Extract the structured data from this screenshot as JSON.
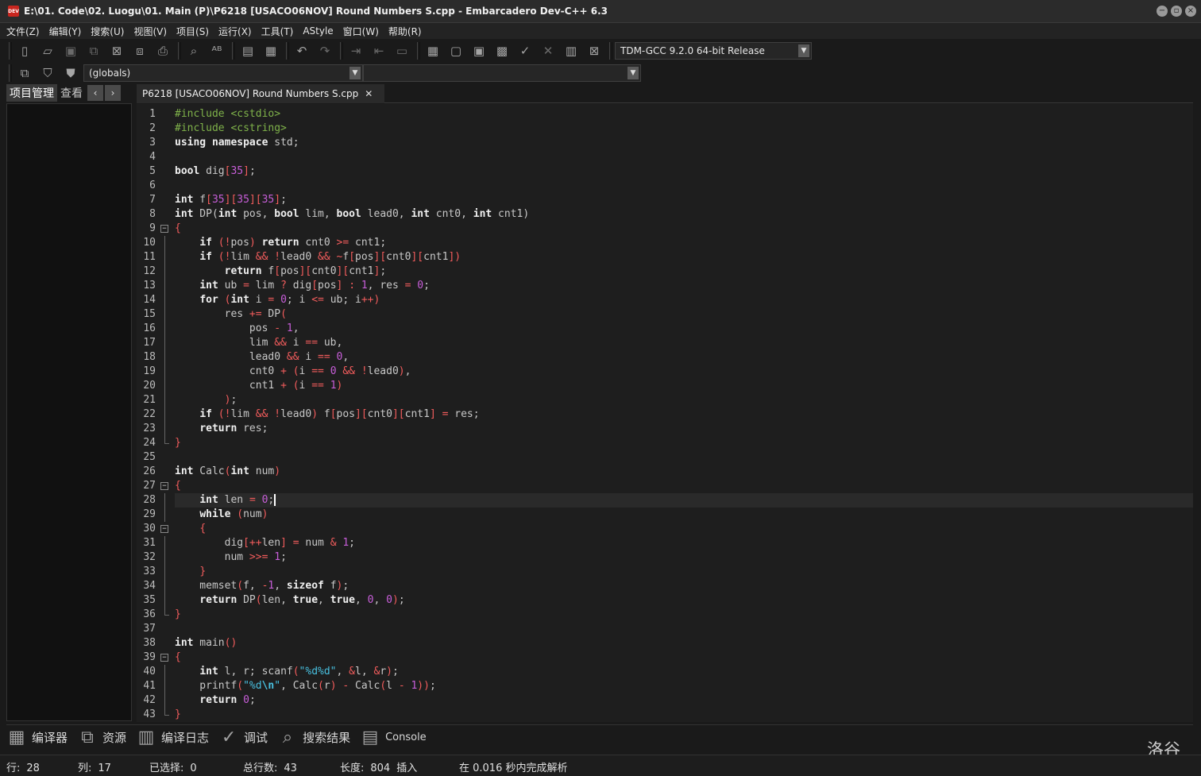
{
  "window": {
    "title": "E:\\01. Code\\02. Luogu\\01. Main (P)\\P6218 [USACO06NOV] Round Numbers S.cpp - Embarcadero Dev-C++ 6.3",
    "icon_text": "DEV",
    "buttons": [
      "minimize",
      "restore",
      "close"
    ]
  },
  "menu": [
    "文件(Z)",
    "编辑(Y)",
    "搜索(U)",
    "视图(V)",
    "项目(S)",
    "运行(X)",
    "工具(T)",
    "AStyle",
    "窗口(W)",
    "帮助(R)"
  ],
  "toolbar": {
    "compiler_select": "TDM-GCC 9.2.0 64-bit Release",
    "scope_select": "(globals)",
    "member_select": ""
  },
  "left_panel": {
    "tabs": [
      "项目管理",
      "查看"
    ],
    "prev_arrow": "‹",
    "next_arrow": "›"
  },
  "editor": {
    "tab_label": "P6218 [USACO06NOV] Round Numbers S.cpp",
    "tab_close": "✕",
    "current_line": 28
  },
  "bottom_tabs": [
    {
      "label": "编译器",
      "icon": "compiler-icon"
    },
    {
      "label": "资源",
      "icon": "resources-icon"
    },
    {
      "label": "编译日志",
      "icon": "compile-log-icon"
    },
    {
      "label": "调试",
      "icon": "debug-icon"
    },
    {
      "label": "搜索结果",
      "icon": "search-results-icon"
    },
    {
      "label": "Console",
      "icon": "console-icon"
    }
  ],
  "watermark": "洛谷",
  "status": {
    "row_label": "行:",
    "row": "28",
    "col_label": "列:",
    "col": "17",
    "selected_label": "已选择:",
    "selected": "0",
    "total_label": "总行数:",
    "total": "43",
    "length_label": "长度:",
    "length": "804",
    "mode": "插入",
    "parse": "在 0.016 秒内完成解析"
  },
  "colors": {
    "keyword": "#f0f0f0",
    "preprocessor": "#7fb24a",
    "number": "#c75ed8",
    "operator": "#f25c5c",
    "string": "#48c0e0",
    "background": "#1e1e1e"
  }
}
